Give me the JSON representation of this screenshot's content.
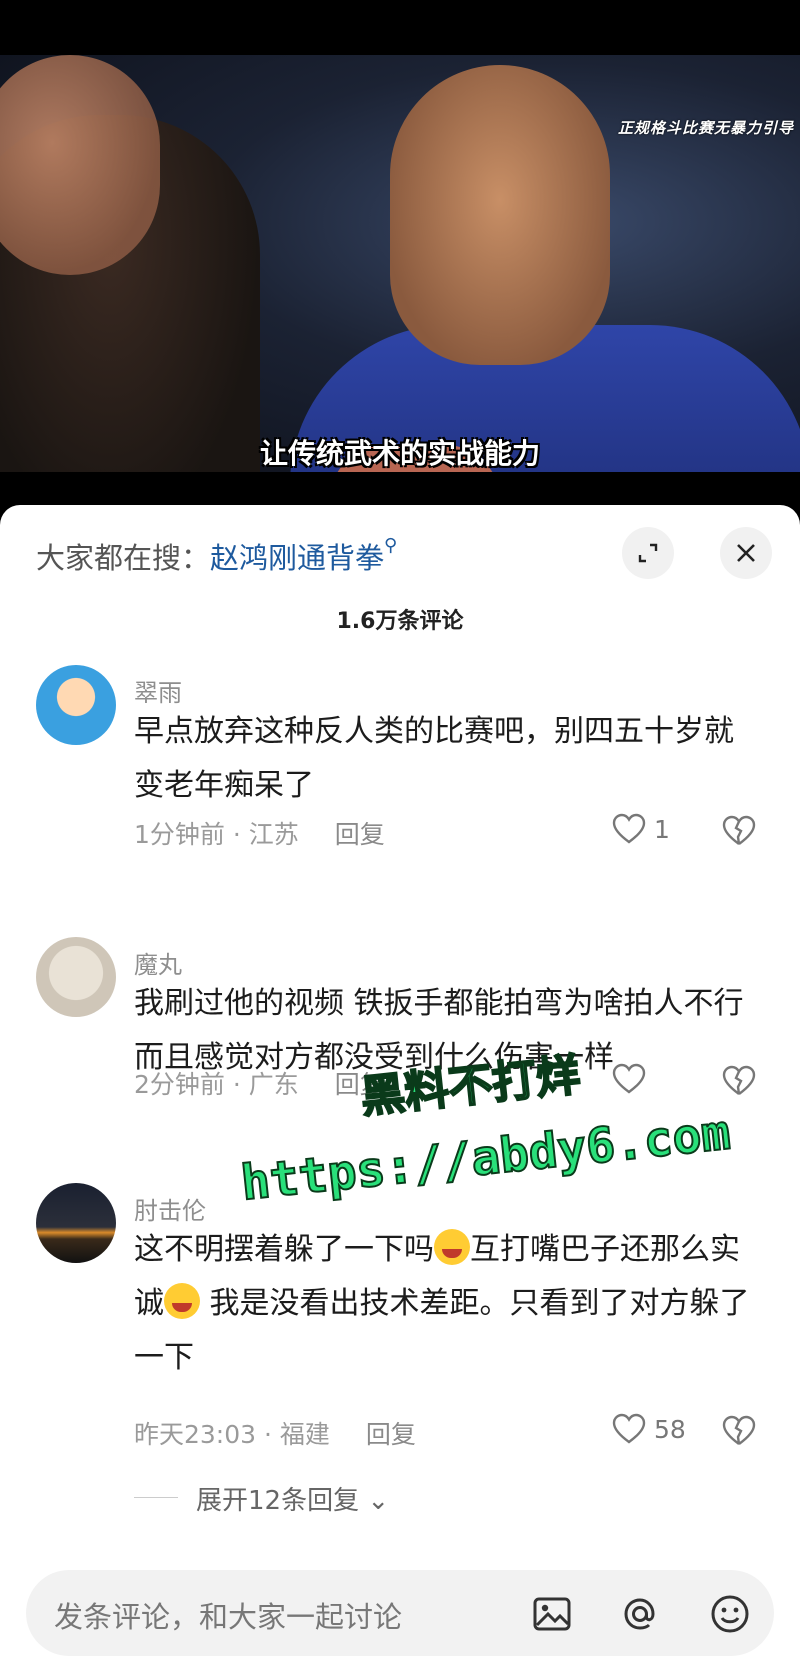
{
  "video": {
    "watermark": "正规格斗比赛无暴力引导",
    "subtitle": "让传统武术的实战能力"
  },
  "search": {
    "prefix": "大家都在搜：",
    "keyword": "赵鸿刚通背拳"
  },
  "comments_count": "1.6万条评论",
  "comments": [
    {
      "author": "翠雨",
      "text": "早点放弃这种反人类的比赛吧，别四五十岁就变老年痴呆了",
      "time_location": "1分钟前 · 江苏",
      "reply_label": "回复",
      "likes": "1"
    },
    {
      "author": "魔丸",
      "text": "我刷过他的视频 铁扳手都能拍弯为啥拍人不行 而且感觉对方都没受到什么伤害一样",
      "time_location": "2分钟前 · 广东",
      "reply_label": "回复",
      "likes": ""
    },
    {
      "author": "肘击伦",
      "text_parts": [
        "这不明摆着躲了一下吗",
        "互打嘴巴子还那么实诚",
        " 我是没看出技术差距。只看到了对方躲了一下"
      ],
      "time_location": "昨天23:03 · 福建",
      "reply_label": "回复",
      "likes": "58"
    }
  ],
  "expand_replies": "展开12条回复",
  "footer": {
    "placeholder": "发条评论，和大家一起讨论"
  },
  "overlay_watermark": {
    "line1": "黑料不打烊",
    "line2": "https://abdy6.com"
  }
}
